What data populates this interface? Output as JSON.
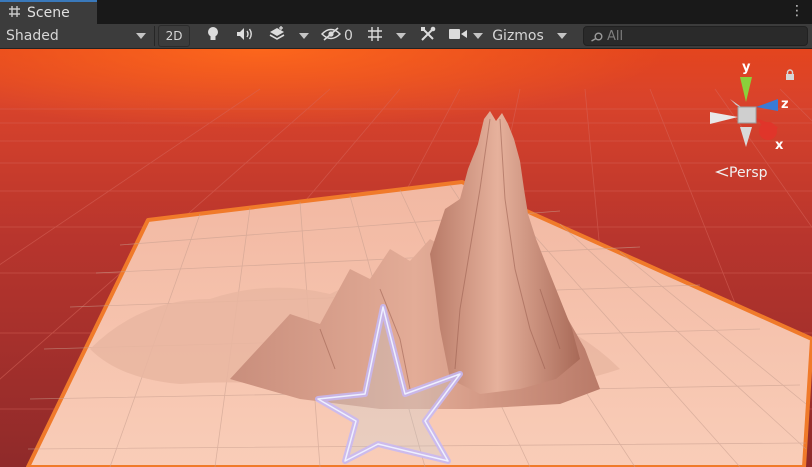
{
  "tab": {
    "title": "Scene",
    "menu_glyph": "⋮"
  },
  "toolbar": {
    "draw_mode": "Shaded",
    "mode_2d": "2D",
    "hidden_count": "0",
    "gizmos_label": "Gizmos",
    "search_placeholder": "All"
  },
  "orientation_gizmo": {
    "axis_y": "y",
    "axis_z": "z",
    "axis_x": "x",
    "projection_label": "Persp"
  },
  "colors": {
    "tab_accent": "#3a79bb",
    "sky": "#c0402d",
    "ground_plane": "#f5c2aa",
    "selection_outline": "#f07a2a",
    "axis_y": "#8ad13b",
    "axis_z": "#3a7bd5",
    "axis_x": "#e0352a"
  },
  "icons": [
    "scene-grid-icon",
    "lighting-bulb-icon",
    "audio-icon",
    "effects-stack-icon",
    "hidden-eye-icon",
    "grid-toggle-icon",
    "tools-icon",
    "camera-icon",
    "search-icon",
    "lock-icon"
  ]
}
